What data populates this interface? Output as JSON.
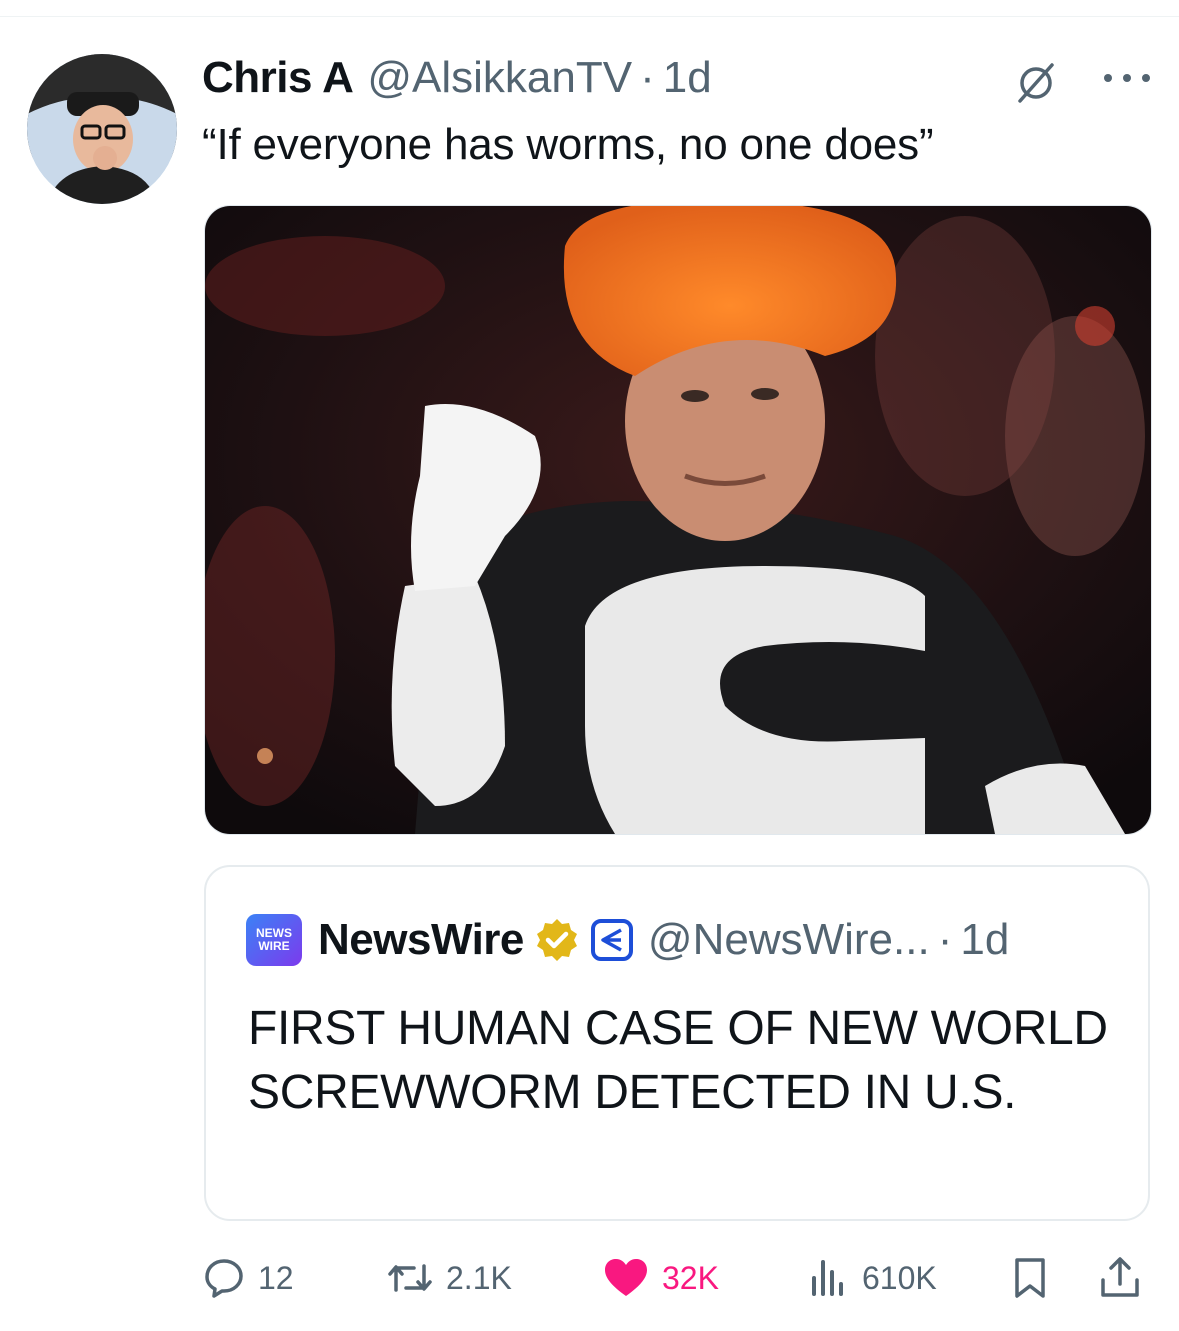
{
  "tweet": {
    "display_name": "Chris A",
    "handle": "@AlsikkanTV",
    "separator": "·",
    "time": "1d",
    "text": "“If everyone has worms, no one does”",
    "icons": {
      "avatar": "avatar",
      "grok": "grok-icon",
      "more": "more-icon"
    }
  },
  "quote": {
    "logo_line1": "NEWS",
    "logo_line2": "WIRE",
    "display_name": "NewsWire",
    "handle": "@NewsWire...",
    "separator": "·",
    "time": "1d",
    "text": "FIRST HUMAN CASE OF NEW WORLD SCREWWORM DETECTED IN U.S.",
    "icons": {
      "verified": "verified-badge-icon",
      "affiliation": "affiliation-badge-icon"
    }
  },
  "actions": {
    "replies": "12",
    "reposts": "2.1K",
    "likes": "32K",
    "views": "610K",
    "icons": [
      "reply-icon",
      "repost-icon",
      "heart-icon",
      "views-icon",
      "bookmark-icon",
      "share-icon"
    ]
  },
  "colors": {
    "text": "#0f1419",
    "secondary": "#536471",
    "like": "#f91880",
    "verified_gold": "#e2b719",
    "border": "#e6ebee"
  }
}
